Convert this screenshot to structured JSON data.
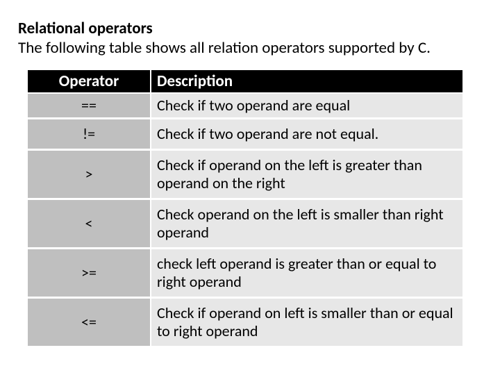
{
  "heading": "Relational operators",
  "intro": "The following table shows all relation operators supported by C.",
  "table": {
    "headers": {
      "operator": "Operator",
      "description": "Description"
    },
    "rows": [
      {
        "op": "==",
        "desc": "Check if two operand are equal"
      },
      {
        "op": "!=",
        "desc": "Check if two operand are not equal."
      },
      {
        "op": ">",
        "desc": "Check if operand on the left is greater than operand on the right"
      },
      {
        "op": "<",
        "desc": "Check operand on the left is smaller than right operand"
      },
      {
        "op": ">=",
        "desc": "check left operand is greater than or equal to right operand"
      },
      {
        "op": "<=",
        "desc": "Check if operand on left is smaller than or equal to right operand"
      }
    ]
  }
}
